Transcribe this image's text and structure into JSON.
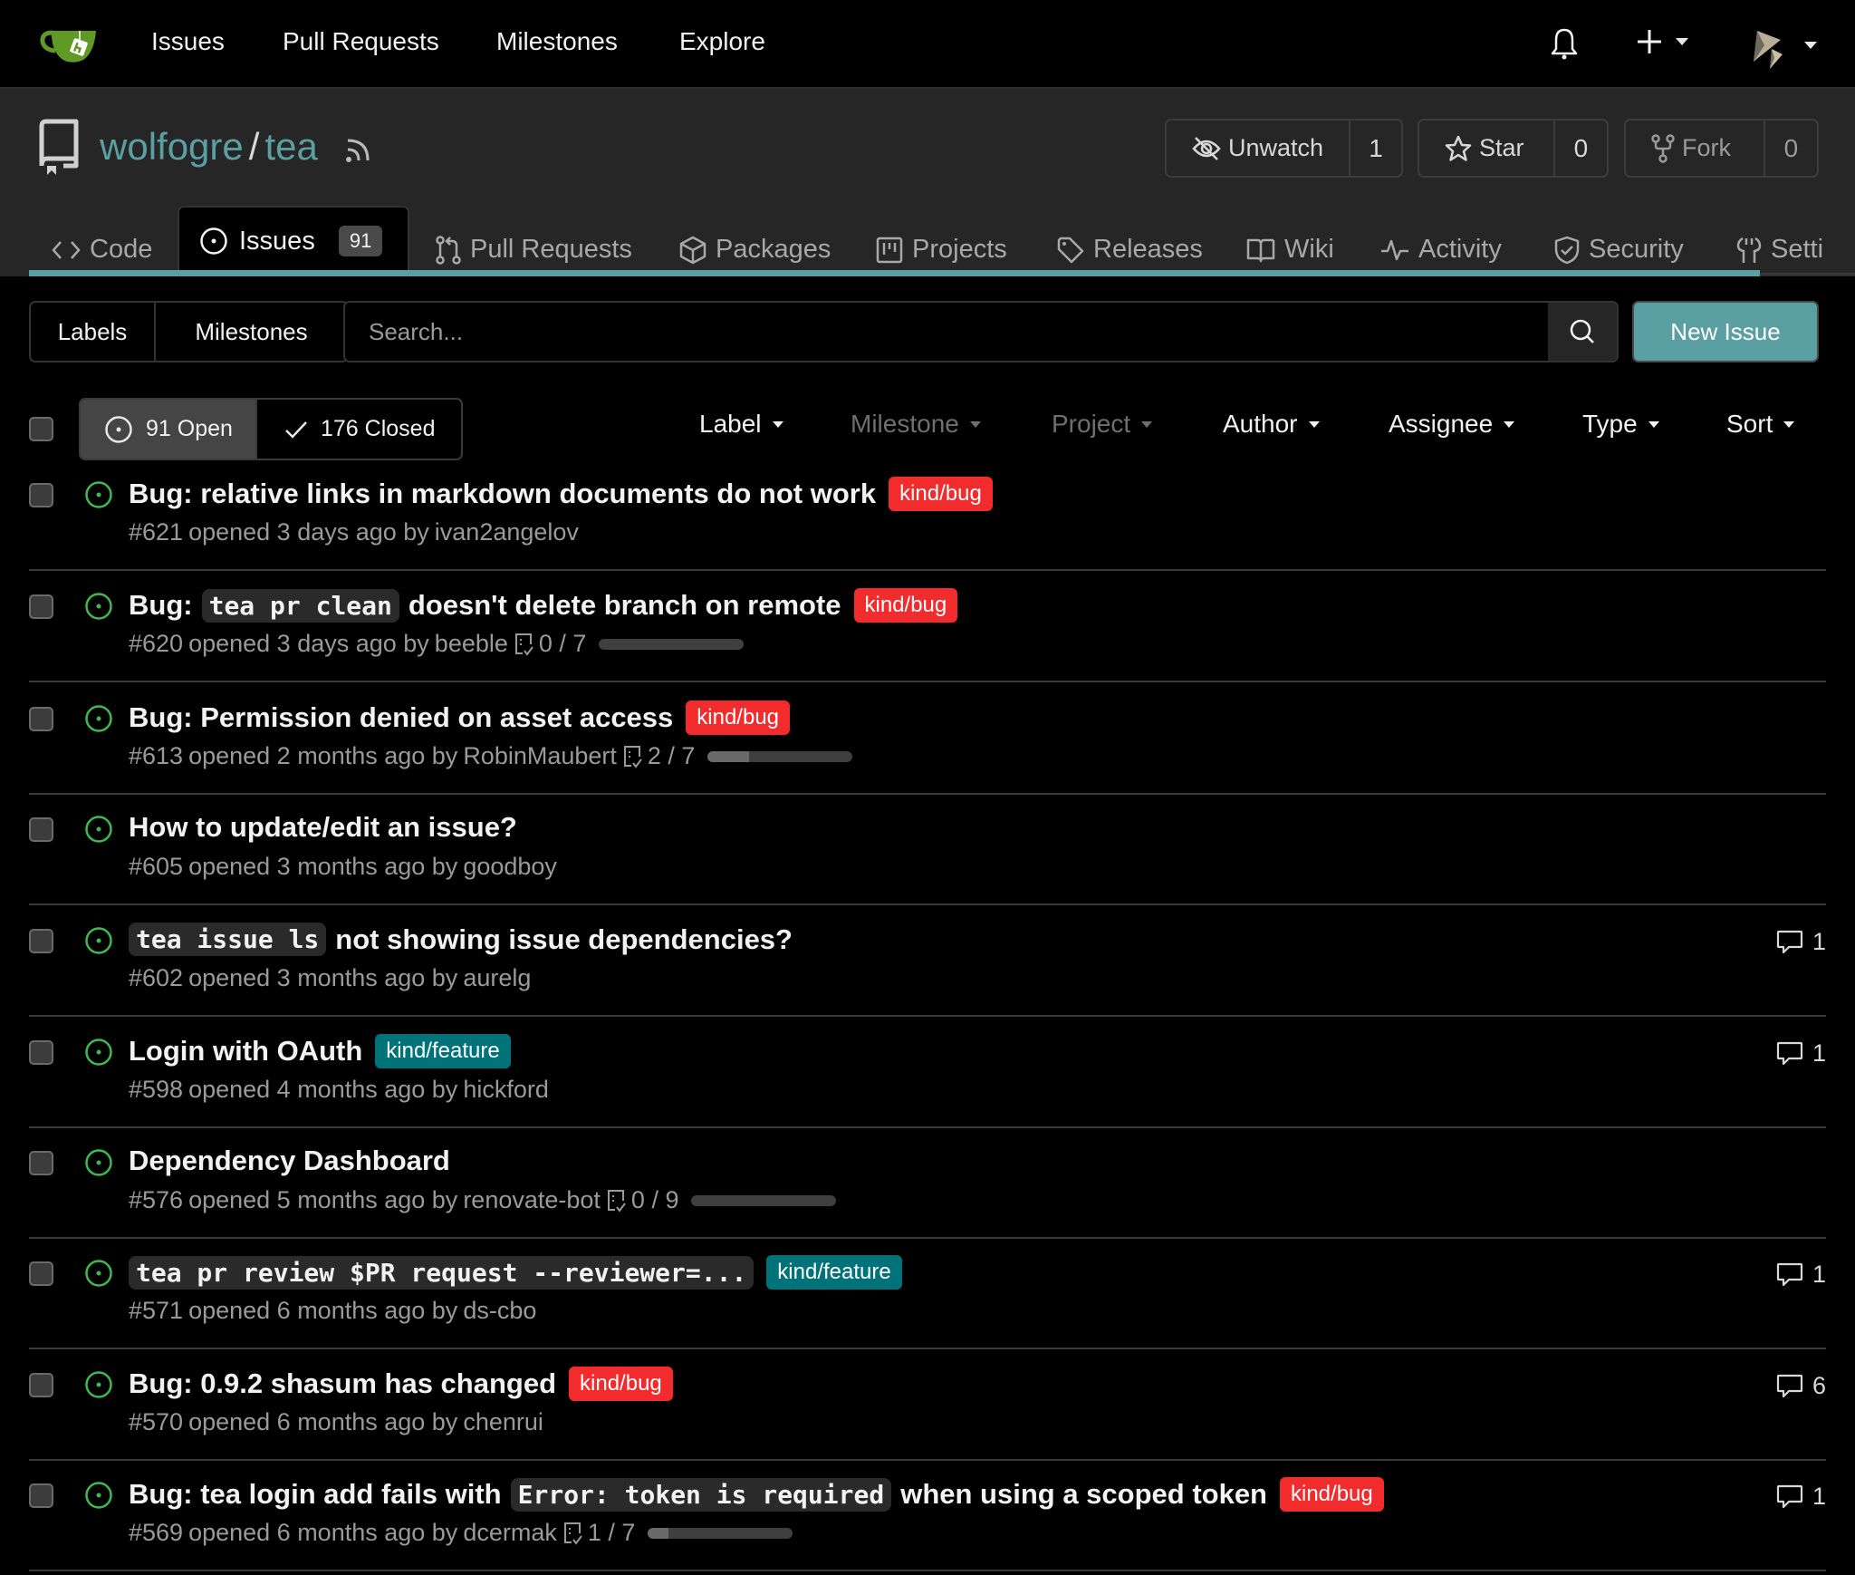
{
  "topbar": {
    "logo": "gitea-logo",
    "nav": [
      {
        "label": "Issues"
      },
      {
        "label": "Pull Requests"
      },
      {
        "label": "Milestones"
      },
      {
        "label": "Explore"
      }
    ],
    "icons": {
      "notifications": "bell-icon",
      "create": "plus-icon",
      "avatar": "user-avatar"
    }
  },
  "repo": {
    "owner": "wolfogre",
    "separator": "/",
    "name": "tea",
    "buttons": {
      "watch": {
        "label": "Unwatch",
        "count": "1"
      },
      "star": {
        "label": "Star",
        "count": "0"
      },
      "fork": {
        "label": "Fork",
        "count": "0"
      }
    }
  },
  "tabs": [
    {
      "label": "Code",
      "icon": "code-icon"
    },
    {
      "label": "Issues",
      "icon": "issue-opened-icon",
      "count": "91",
      "active": true
    },
    {
      "label": "Pull Requests",
      "icon": "git-pull-request-icon"
    },
    {
      "label": "Packages",
      "icon": "package-icon"
    },
    {
      "label": "Projects",
      "icon": "project-icon"
    },
    {
      "label": "Releases",
      "icon": "tag-icon"
    },
    {
      "label": "Wiki",
      "icon": "book-icon"
    },
    {
      "label": "Activity",
      "icon": "pulse-icon"
    },
    {
      "label": "Security",
      "icon": "shield-check-icon"
    },
    {
      "label": "Setti",
      "icon": "tools-icon"
    }
  ],
  "toolbar": {
    "labels_button": "Labels",
    "milestones_button": "Milestones",
    "search_placeholder": "Search...",
    "search_value": "",
    "new_issue_button": "New Issue"
  },
  "state": {
    "open_label": "91 Open",
    "closed_label": "176 Closed"
  },
  "filters": [
    {
      "label": "Label",
      "enabled": true
    },
    {
      "label": "Milestone",
      "enabled": false
    },
    {
      "label": "Project",
      "enabled": false
    },
    {
      "label": "Author",
      "enabled": true
    },
    {
      "label": "Assignee",
      "enabled": true
    },
    {
      "label": "Type",
      "enabled": true
    },
    {
      "label": "Sort",
      "enabled": true
    }
  ],
  "colors": {
    "accent": "#5aa0a3",
    "open_icon": "#3fb950",
    "label_bug": "#f22c2c",
    "label_feature": "#00727a"
  },
  "issues": [
    {
      "title_parts": [
        {
          "text": "Bug: relative links in markdown documents do not work"
        }
      ],
      "labels": [
        {
          "text": "kind/bug",
          "kind": "bug"
        }
      ],
      "number": "#621",
      "meta": "opened 3 days ago by",
      "author": "ivan2angelov",
      "tasks": null,
      "comments": null
    },
    {
      "title_parts": [
        {
          "text": "Bug:"
        },
        {
          "code": "tea pr clean"
        },
        {
          "text": "doesn't delete branch on remote"
        }
      ],
      "labels": [
        {
          "text": "kind/bug",
          "kind": "bug"
        }
      ],
      "number": "#620",
      "meta": "opened 3 days ago by",
      "author": "beeble",
      "tasks": {
        "done": 0,
        "total": 7,
        "text": "0 / 7"
      },
      "comments": null
    },
    {
      "title_parts": [
        {
          "text": "Bug: Permission denied on asset access"
        }
      ],
      "labels": [
        {
          "text": "kind/bug",
          "kind": "bug"
        }
      ],
      "number": "#613",
      "meta": "opened 2 months ago by",
      "author": "RobinMaubert",
      "tasks": {
        "done": 2,
        "total": 7,
        "text": "2 / 7"
      },
      "comments": null
    },
    {
      "title_parts": [
        {
          "text": "How to update/edit an issue?"
        }
      ],
      "labels": [],
      "number": "#605",
      "meta": "opened 3 months ago by",
      "author": "goodboy",
      "tasks": null,
      "comments": null
    },
    {
      "title_parts": [
        {
          "code": "tea issue ls"
        },
        {
          "text": "not showing issue dependencies?"
        }
      ],
      "labels": [],
      "number": "#602",
      "meta": "opened 3 months ago by",
      "author": "aurelg",
      "tasks": null,
      "comments": "1"
    },
    {
      "title_parts": [
        {
          "text": "Login with OAuth"
        }
      ],
      "labels": [
        {
          "text": "kind/feature",
          "kind": "feature"
        }
      ],
      "number": "#598",
      "meta": "opened 4 months ago by",
      "author": "hickford",
      "tasks": null,
      "comments": "1"
    },
    {
      "title_parts": [
        {
          "text": "Dependency Dashboard"
        }
      ],
      "labels": [],
      "number": "#576",
      "meta": "opened 5 months ago by",
      "author": "renovate-bot",
      "tasks": {
        "done": 0,
        "total": 9,
        "text": "0 / 9"
      },
      "comments": null
    },
    {
      "title_parts": [
        {
          "code": "tea pr review $PR request --reviewer=..."
        }
      ],
      "labels": [
        {
          "text": "kind/feature",
          "kind": "feature"
        }
      ],
      "number": "#571",
      "meta": "opened 6 months ago by",
      "author": "ds-cbo",
      "tasks": null,
      "comments": "1"
    },
    {
      "title_parts": [
        {
          "text": "Bug: 0.9.2 shasum has changed"
        }
      ],
      "labels": [
        {
          "text": "kind/bug",
          "kind": "bug"
        }
      ],
      "number": "#570",
      "meta": "opened 6 months ago by",
      "author": "chenrui",
      "tasks": null,
      "comments": "6"
    },
    {
      "title_parts": [
        {
          "text": "Bug: tea login add fails with"
        },
        {
          "code": "Error: token is required"
        },
        {
          "text": "when using a scoped token"
        }
      ],
      "labels": [
        {
          "text": "kind/bug",
          "kind": "bug"
        }
      ],
      "number": "#569",
      "meta": "opened 6 months ago by",
      "author": "dcermak",
      "tasks": {
        "done": 1,
        "total": 7,
        "text": "1 / 7"
      },
      "comments": "1"
    }
  ]
}
